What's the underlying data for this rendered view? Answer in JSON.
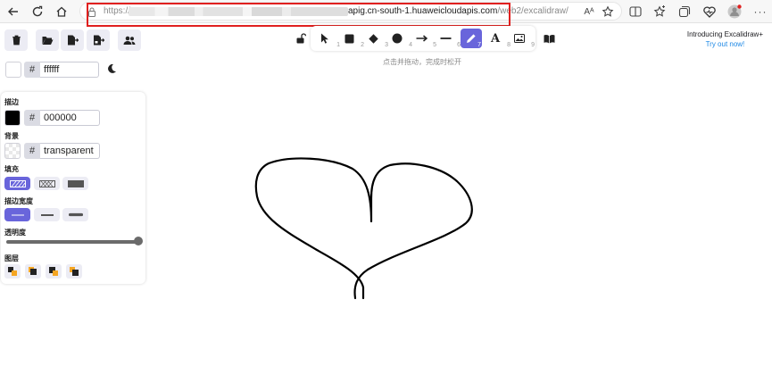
{
  "browser": {
    "url_protocol": "https://",
    "url_host": "apig.cn-south-1.huaweicloudapis.com",
    "url_path": "/web2/excalidraw/",
    "reader_label": "Aᴬ"
  },
  "canvas_top": {
    "theme_hex": "ffffff"
  },
  "properties": {
    "stroke_label": "描边",
    "stroke_hex": "000000",
    "stroke_color": "#000000",
    "background_label": "背景",
    "background_value": "transparent",
    "fill_label": "填充",
    "stroke_width_label": "描边宽度",
    "opacity_label": "透明度",
    "opacity": 1.0,
    "layers_label": "图层"
  },
  "toolbar": {
    "tools": [
      {
        "name": "selection",
        "num": "1"
      },
      {
        "name": "rectangle",
        "num": "2"
      },
      {
        "name": "diamond",
        "num": "3"
      },
      {
        "name": "ellipse",
        "num": "4"
      },
      {
        "name": "arrow",
        "num": "5"
      },
      {
        "name": "line",
        "num": "6"
      },
      {
        "name": "freedraw",
        "num": "7"
      },
      {
        "name": "text",
        "num": "8"
      },
      {
        "name": "image",
        "num": "9"
      }
    ],
    "active_tool": "freedraw"
  },
  "hint": "点击并拖动，完成时松开",
  "promo": {
    "line1": "Introducing Excalidraw+",
    "line2": "Try out now!"
  },
  "colors": {
    "accent": "#6965db",
    "highlight_box": "#e0201f",
    "link": "#1e88e5"
  }
}
